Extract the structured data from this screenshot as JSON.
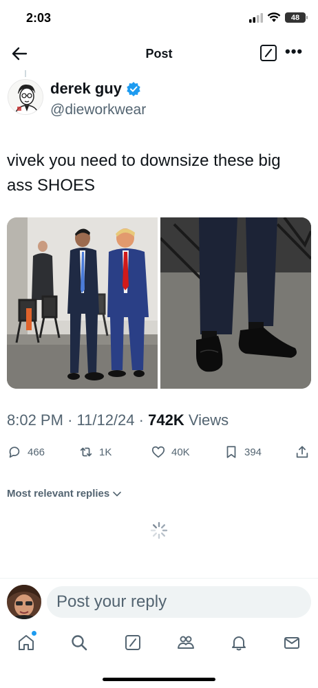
{
  "status_bar": {
    "time": "2:03",
    "battery": "48"
  },
  "nav": {
    "title": "Post",
    "icons": [
      "back-arrow-icon",
      "grok-icon",
      "more-icon"
    ]
  },
  "tweet": {
    "author_name": "derek guy",
    "author_handle": "@dieworkwear",
    "text": "vivek you need to downsize these big ass SHOES",
    "time": "8:02 PM",
    "date": "11/12/24",
    "views_count": "742K",
    "views_label": "Views",
    "media": [
      "photo-two-men-suits",
      "photo-shoes-closeup"
    ]
  },
  "actions": {
    "replies": "466",
    "reposts": "1K",
    "likes": "40K",
    "bookmarks": "394"
  },
  "replies_sort": "Most relevant replies",
  "reply_placeholder": "Post your reply",
  "tabs": [
    "home-icon",
    "search-icon",
    "grok-icon",
    "communities-icon",
    "notifications-icon",
    "messages-icon"
  ],
  "colors": {
    "accent": "#1d9bf0",
    "text": "#0f1419",
    "secondary": "#536471",
    "input_bg": "#eff3f4"
  }
}
